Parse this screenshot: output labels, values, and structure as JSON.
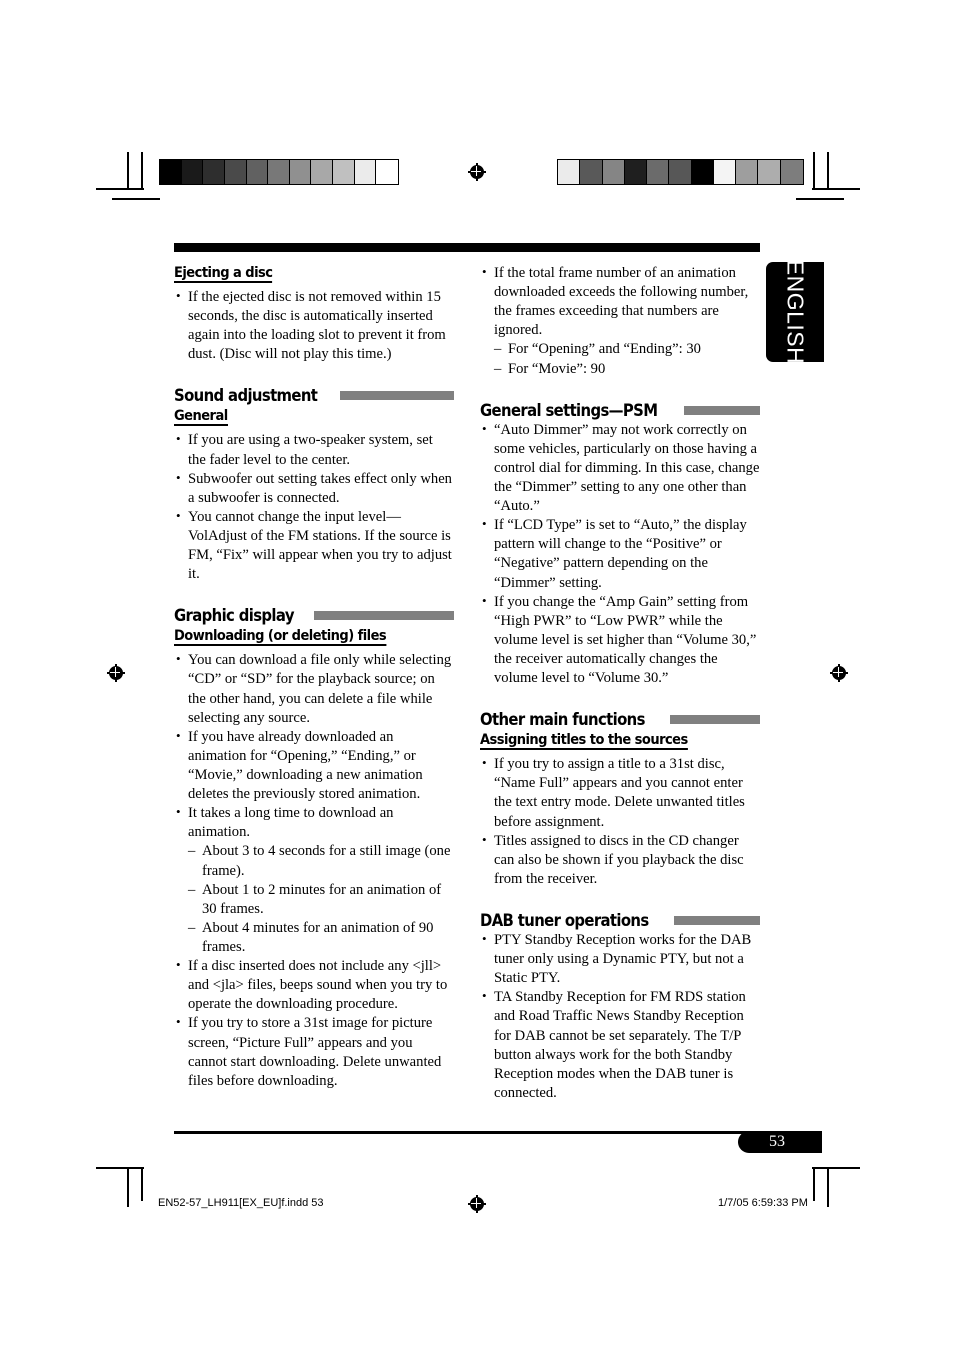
{
  "language_tab": {
    "label": "ENGLISH"
  },
  "page_number": "53",
  "footer": {
    "file_name": "EN52-57_LH911[EX_EU]f.indd   53",
    "timestamp": "1/7/05   6:59:33 PM"
  },
  "calibration": {
    "left_bar_swatches": [
      "#000000",
      "#1a1a1a",
      "#2e2e2e",
      "#4a4a4a",
      "#616161",
      "#787878",
      "#909090",
      "#a8a8a8",
      "#c0c0c0",
      "#ebebeb",
      "#ffffff"
    ],
    "right_bar_swatches": [
      "#ebebeb",
      "#595959",
      "#858585",
      "#1f1f1f",
      "#6b6b6b",
      "#575757",
      "#000000",
      "#f4f4f4",
      "#9e9e9e",
      "#adadad",
      "#7d7d7d"
    ]
  },
  "colors": {
    "rule": "#000000",
    "section_bar": "#808080",
    "tab_background": "#000000",
    "tab_text": "#ffffff"
  },
  "left_column": {
    "heading_ejecting": "Ejecting a disc",
    "ejecting_bullets": [
      "If the ejected disc is not removed within 15 seconds, the disc is automatically inserted again into the loading slot to prevent it from dust. (Disc will not play this time.)"
    ],
    "section_sound": "Sound adjustment",
    "sub_general": "General",
    "general_bullets": [
      "If you are using a two-speaker system, set the fader level to the center.",
      "Subwoofer out setting takes effect only when a subwoofer is connected.",
      "You cannot change the input level—VolAdjust of the FM stations. If the source is FM, “Fix” will appear when you try to adjust it."
    ],
    "section_graphic": "Graphic display",
    "sub_downloading": "Downloading (or deleting) files",
    "downloading_bullets": [
      "You can download a file only while selecting “CD” or “SD” for the playback source; on the other hand, you can delete a file while selecting any source.",
      "If you have already downloaded an animation for “Opening,” “Ending,” or “Movie,” downloading a new animation deletes the previously stored animation."
    ],
    "download_time_lead": "It takes a long time to download an animation.",
    "download_time_items": [
      "About 3 to 4 seconds for a still image (one frame).",
      "About 1 to 2 minutes for an animation of 30 frames.",
      "About 4 minutes for an animation of 90 frames."
    ],
    "downloading_bullets_tail": [
      "If a disc inserted does not include any <jll> and <jla> files, beeps sound when you try to operate the downloading procedure.",
      "If you try to store a 31st image for picture screen, “Picture Full” appears and you cannot start downloading. Delete unwanted files before downloading."
    ]
  },
  "right_column": {
    "frame_bullet_lead": "If the total frame number of an animation downloaded exceeds the following number, the frames exceeding that numbers are ignored.",
    "frame_items": [
      "For “Opening” and  “Ending”: 30",
      "For “Movie”: 90"
    ],
    "section_psm": "General settings—PSM",
    "psm_bullets": [
      "“Auto Dimmer” may not work correctly on some vehicles, particularly on those having a control dial for dimming. In this case, change the “Dimmer” setting to any one other than “Auto.”",
      " If “LCD Type” is set to “Auto,” the display pattern will change to the “Positive” or “Negative” pattern depending on the “Dimmer” setting.",
      "If you change the “Amp Gain” setting from “High PWR” to “Low PWR” while the volume level is set higher than “Volume 30,” the receiver automatically changes the volume level to “Volume 30.”"
    ],
    "section_other": "Other main functions",
    "sub_assigning": "Assigning titles to the sources",
    "assigning_bullets": [
      "If you try to assign a title to a 31st disc, “Name Full” appears and you cannot enter the text entry mode. Delete unwanted titles before assignment.",
      "Titles assigned to discs in the CD changer can also be shown if you playback the disc from the receiver."
    ],
    "section_dab": "DAB tuner operations",
    "dab_bullets": [
      "PTY Standby Reception works for the DAB tuner only using a Dynamic PTY, but not a Static PTY.",
      "TA Standby Reception for FM RDS station and Road Traffic News Standby Reception for DAB cannot be set separately. The T/P button always work for the both Standby Reception modes when the DAB tuner is connected."
    ]
  }
}
